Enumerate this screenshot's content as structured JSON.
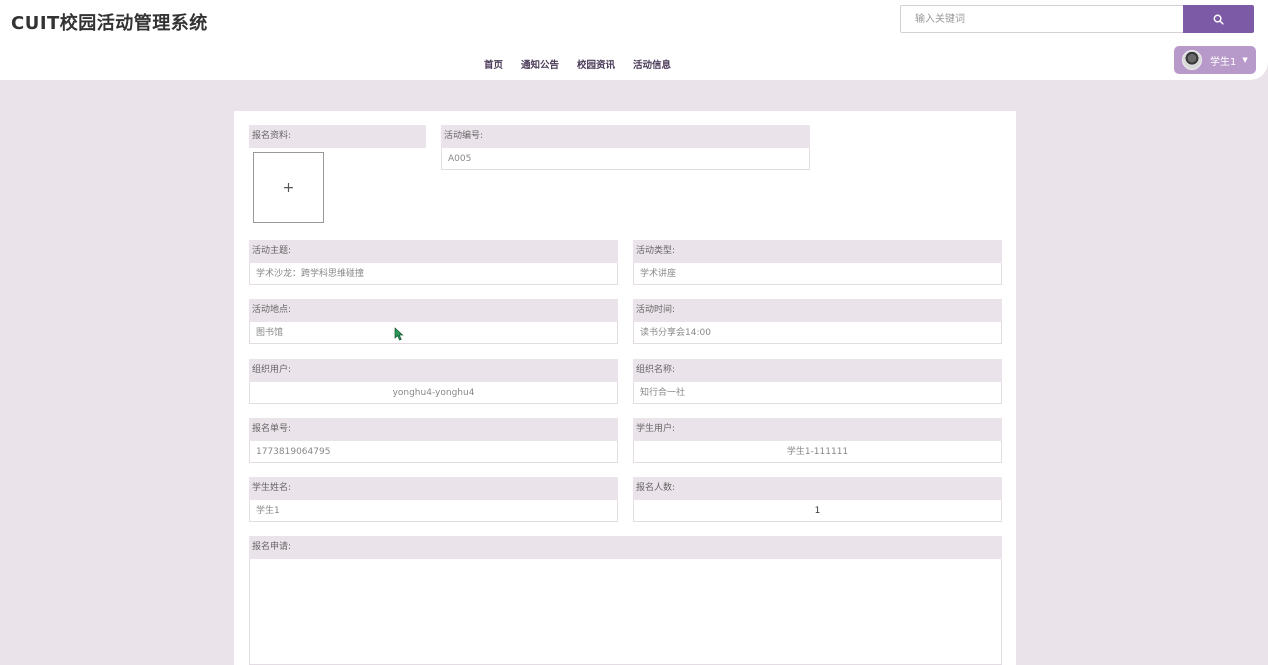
{
  "header": {
    "app_title": "CUIT校园活动管理系统",
    "search": {
      "placeholder": "输入关键词"
    },
    "nav": [
      {
        "label": "首页"
      },
      {
        "label": "通知公告"
      },
      {
        "label": "校园资讯"
      },
      {
        "label": "活动信息"
      }
    ],
    "user": {
      "name": "学生1"
    }
  },
  "form": {
    "upload_label": "报名资料:",
    "activity_no": {
      "label": "活动编号:",
      "value": "A005"
    },
    "topic": {
      "label": "活动主题:",
      "value": "学术沙龙：跨学科思维碰撞"
    },
    "type": {
      "label": "活动类型:",
      "value": "学术讲座"
    },
    "location": {
      "label": "活动地点:",
      "value": "图书馆"
    },
    "time": {
      "label": "活动时间:",
      "value": "读书分享会14:00"
    },
    "org_user": {
      "label": "组织用户:",
      "value": "yonghu4-yonghu4"
    },
    "org_name": {
      "label": "组织名称:",
      "value": "知行合一社"
    },
    "order_no": {
      "label": "报名单号:",
      "value": "1773819064795"
    },
    "student_user": {
      "label": "学生用户:",
      "value": "学生1-111111"
    },
    "student_name": {
      "label": "学生姓名:",
      "value": "学生1"
    },
    "count": {
      "label": "报名人数:",
      "value": "1"
    },
    "application": {
      "label": "报名申请:",
      "value": ""
    }
  },
  "colors": {
    "accent": "#7c5aa6",
    "user_button": "#b79ac9",
    "page_bg": "#ebe3ea"
  },
  "icons": {
    "search_button": "search-icon",
    "user_menu": "chevron-down-icon",
    "upload": "plus-icon"
  }
}
